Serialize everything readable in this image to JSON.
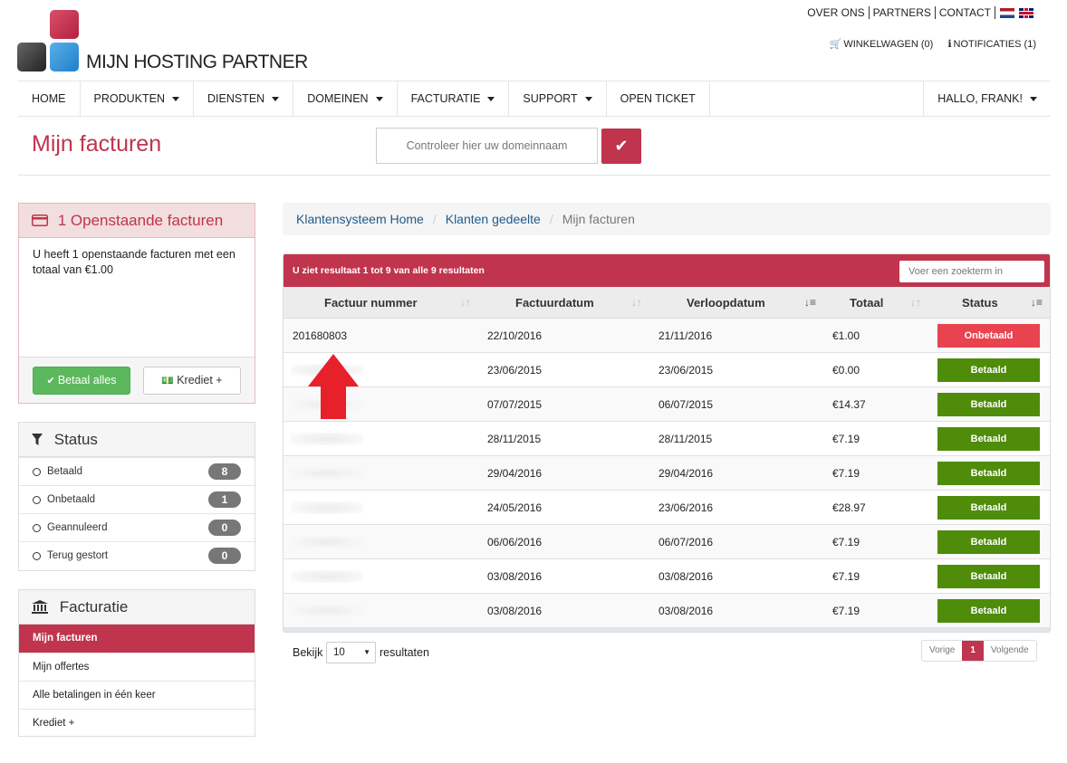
{
  "brand": {
    "name": "MIJN HOSTING PARTNER"
  },
  "toplinks": [
    "OVER ONS",
    "PARTNERS",
    "CONTACT"
  ],
  "cart": {
    "winkelwagen": "WINKELWAGEN (0)",
    "notificaties": "NOTIFICATIES (1)"
  },
  "nav": {
    "items": [
      {
        "label": "HOME",
        "caret": false
      },
      {
        "label": "PRODUKTEN",
        "caret": true
      },
      {
        "label": "DIENSTEN",
        "caret": true
      },
      {
        "label": "DOMEINEN",
        "caret": true
      },
      {
        "label": "FACTURATIE",
        "caret": true
      },
      {
        "label": "SUPPORT",
        "caret": true
      },
      {
        "label": "OPEN TICKET",
        "caret": false
      }
    ],
    "user": "HALLO, FRANK!"
  },
  "page": {
    "title": "Mijn facturen",
    "domain_placeholder": "Controleer hier uw domeinnaam"
  },
  "sidebar": {
    "open_invoices": {
      "title": "1 Openstaande facturen",
      "text": "U heeft 1 openstaande facturen met een totaal van €1.00",
      "pay_all": "Betaal alles",
      "credit": "Krediet +"
    },
    "status": {
      "title": "Status",
      "items": [
        {
          "label": "Betaald",
          "count": "8"
        },
        {
          "label": "Onbetaald",
          "count": "1"
        },
        {
          "label": "Geannuleerd",
          "count": "0"
        },
        {
          "label": "Terug gestort",
          "count": "0"
        }
      ]
    },
    "facturatie": {
      "title": "Facturatie",
      "items": [
        "Mijn facturen",
        "Mijn offertes",
        "Alle betalingen in één keer",
        "Krediet +"
      ]
    }
  },
  "breadcrumb": {
    "home": "Klantensysteem Home",
    "section": "Klanten gedeelte",
    "current": "Mijn facturen"
  },
  "table": {
    "result_info": "U ziet resultaat 1 tot 9 van alle 9 resultaten",
    "search_placeholder": "Voer een zoekterm in",
    "headers": [
      "Factuur nummer",
      "Factuurdatum",
      "Verloopdatum",
      "Totaal",
      "Status"
    ],
    "rows": [
      {
        "number": "201680803",
        "date": "22/10/2016",
        "due": "21/11/2016",
        "total": "€1.00",
        "status": "Onbetaald"
      },
      {
        "number": "",
        "date": "23/06/2015",
        "due": "23/06/2015",
        "total": "€0.00",
        "status": "Betaald"
      },
      {
        "number": "",
        "date": "07/07/2015",
        "due": "06/07/2015",
        "total": "€14.37",
        "status": "Betaald"
      },
      {
        "number": "",
        "date": "28/11/2015",
        "due": "28/11/2015",
        "total": "€7.19",
        "status": "Betaald"
      },
      {
        "number": "",
        "date": "29/04/2016",
        "due": "29/04/2016",
        "total": "€7.19",
        "status": "Betaald"
      },
      {
        "number": "",
        "date": "24/05/2016",
        "due": "23/06/2016",
        "total": "€28.97",
        "status": "Betaald"
      },
      {
        "number": "",
        "date": "06/06/2016",
        "due": "06/07/2016",
        "total": "€7.19",
        "status": "Betaald"
      },
      {
        "number": "",
        "date": "03/08/2016",
        "due": "03/08/2016",
        "total": "€7.19",
        "status": "Betaald"
      },
      {
        "number": "",
        "date": "03/08/2016",
        "due": "03/08/2016",
        "total": "€7.19",
        "status": "Betaald"
      }
    ]
  },
  "footer": {
    "show": "Bekijk",
    "per_page": "10",
    "results": "resultaten",
    "prev": "Vorige",
    "page": "1",
    "next": "Volgende"
  },
  "colors": {
    "accent": "#c0344d",
    "paid": "#4e8c0a",
    "unpaid": "#e8434f",
    "pay_button": "#5cb85c"
  }
}
